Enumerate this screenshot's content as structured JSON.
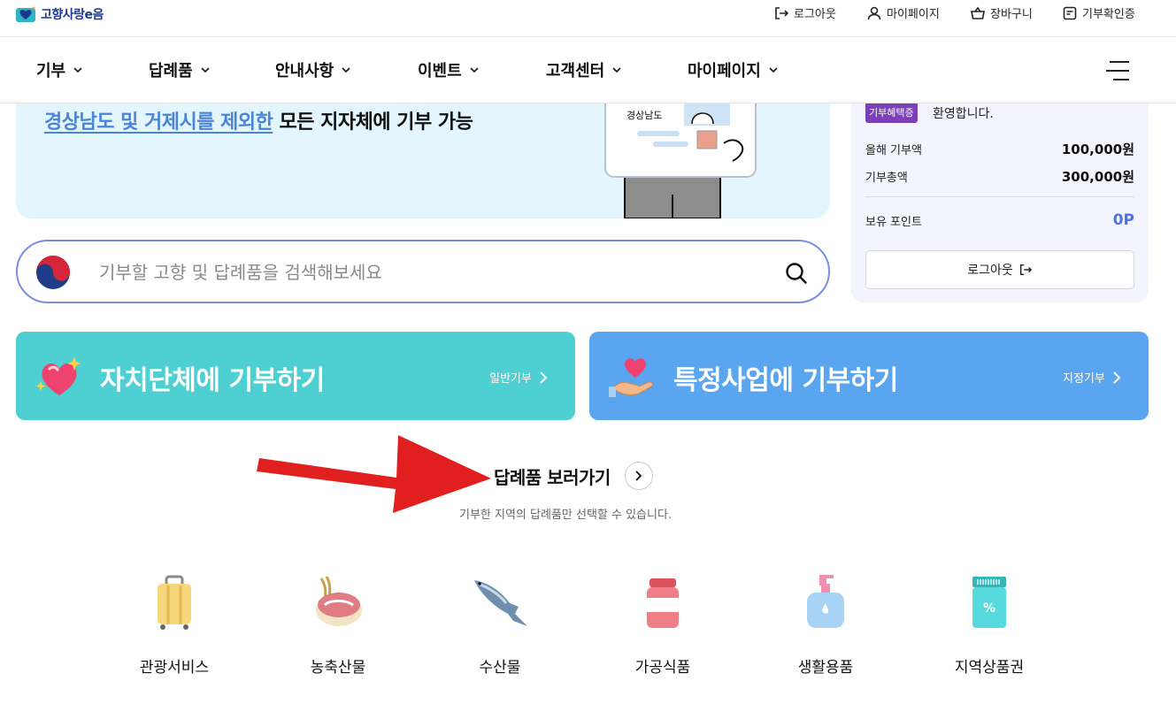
{
  "brand": {
    "logo_text": "고향사랑e음"
  },
  "utility": {
    "logout": "로그아웃",
    "mypage": "마이페이지",
    "cart": "장바구니",
    "donation_confirm": "기부확인증"
  },
  "nav": {
    "items": [
      {
        "label": "기부"
      },
      {
        "label": "답례품"
      },
      {
        "label": "안내사항"
      },
      {
        "label": "이벤트"
      },
      {
        "label": "고객센터"
      },
      {
        "label": "마이페이지"
      }
    ]
  },
  "banner": {
    "highlight": "경상남도 및 거제시를 제외한",
    "rest": " 모든 지자체에 기부 가능",
    "card_label": "경상남도"
  },
  "panel": {
    "badge": "기부혜택증",
    "welcome": "환영합니다.",
    "rows": [
      {
        "label": "올해 기부액",
        "value": "100,000원"
      },
      {
        "label": "기부총액",
        "value": "300,000원"
      }
    ],
    "points_label": "보유 포인트",
    "points_value": "0P",
    "logout_button": "로그아웃"
  },
  "search": {
    "placeholder": "기부할 고향 및 답례품을 검색해보세요"
  },
  "cards": [
    {
      "title": "자치단체에 기부하기",
      "sub": "일반기부"
    },
    {
      "title": "특정사업에 기부하기",
      "sub": "지정기부"
    }
  ],
  "goods": {
    "title": "답례품 보러가기",
    "desc": "기부한 지역의 답례품만 선택할 수 있습니다."
  },
  "categories": [
    {
      "label": "관광서비스",
      "icon": "suitcase-icon"
    },
    {
      "label": "농축산물",
      "icon": "meat-wheat-icon"
    },
    {
      "label": "수산물",
      "icon": "fish-icon"
    },
    {
      "label": "가공식품",
      "icon": "jar-icon"
    },
    {
      "label": "생활용품",
      "icon": "lotion-icon"
    },
    {
      "label": "지역상품권",
      "icon": "voucher-icon"
    }
  ],
  "colors": {
    "accent_teal": "#4ecfd2",
    "accent_blue": "#5aa5ef",
    "badge_purple": "#7b3fb8",
    "points_blue": "#4d72e6",
    "arrow_red": "#e21f1f"
  }
}
